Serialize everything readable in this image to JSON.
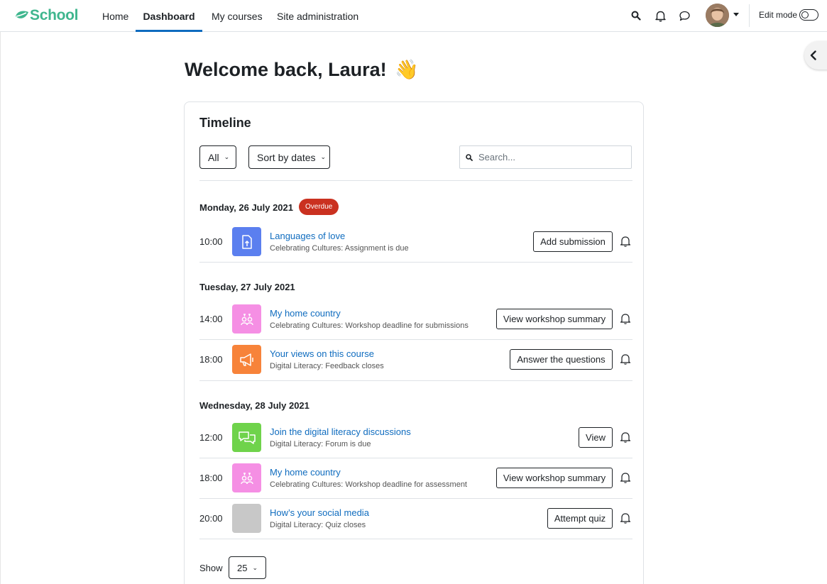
{
  "brand": {
    "name": "School",
    "color": "#3fb68e"
  },
  "nav": {
    "items": [
      {
        "label": "Home"
      },
      {
        "label": "Dashboard",
        "active": true
      },
      {
        "label": "My courses"
      },
      {
        "label": "Site administration"
      }
    ],
    "edit_mode_label": "Edit mode",
    "icons": [
      "search-icon",
      "bell-icon",
      "chat-icon",
      "avatar",
      "chevron-down-icon"
    ]
  },
  "page": {
    "welcome": "Welcome back, Laura!",
    "wave_emoji": "👋"
  },
  "timeline": {
    "title": "Timeline",
    "filter": {
      "selected": "All"
    },
    "sort": {
      "selected": "Sort by dates"
    },
    "search_placeholder": "Search...",
    "groups": [
      {
        "date": "Monday, 26 July 2021",
        "badge": "Overdue",
        "events": [
          {
            "time": "10:00",
            "title": "Languages of love",
            "subtitle": "Celebrating Cultures: Assignment is due",
            "action": "Add submission",
            "icon": "assignment-icon",
            "color": "#5b7fef"
          }
        ]
      },
      {
        "date": "Tuesday, 27 July 2021",
        "events": [
          {
            "time": "14:00",
            "title": "My home country",
            "subtitle": "Celebrating Cultures: Workshop deadline for submissions",
            "action": "View workshop summary",
            "icon": "workshop-icon",
            "color": "#f58fe4"
          },
          {
            "time": "18:00",
            "title": "Your views on this course",
            "subtitle": "Digital Literacy: Feedback closes",
            "action": "Answer the questions",
            "icon": "megaphone-icon",
            "color": "#f7833a"
          }
        ]
      },
      {
        "date": "Wednesday, 28 July 2021",
        "events": [
          {
            "time": "12:00",
            "title": "Join the digital literacy discussions",
            "subtitle": "Digital Literacy: Forum is due",
            "action": "View",
            "icon": "forum-icon",
            "color": "#6fd34b"
          },
          {
            "time": "18:00",
            "title": "My home country",
            "subtitle": "Celebrating Cultures: Workshop deadline for assessment",
            "action": "View workshop summary",
            "icon": "workshop-icon",
            "color": "#f58fe4"
          },
          {
            "time": "20:00",
            "title": "How’s your social media",
            "subtitle": "Digital Literacy: Quiz closes",
            "action": "Attempt quiz",
            "icon": "quiz-icon",
            "color": "#c8c8c8"
          }
        ]
      }
    ],
    "show_label": "Show",
    "show_value": "25"
  }
}
